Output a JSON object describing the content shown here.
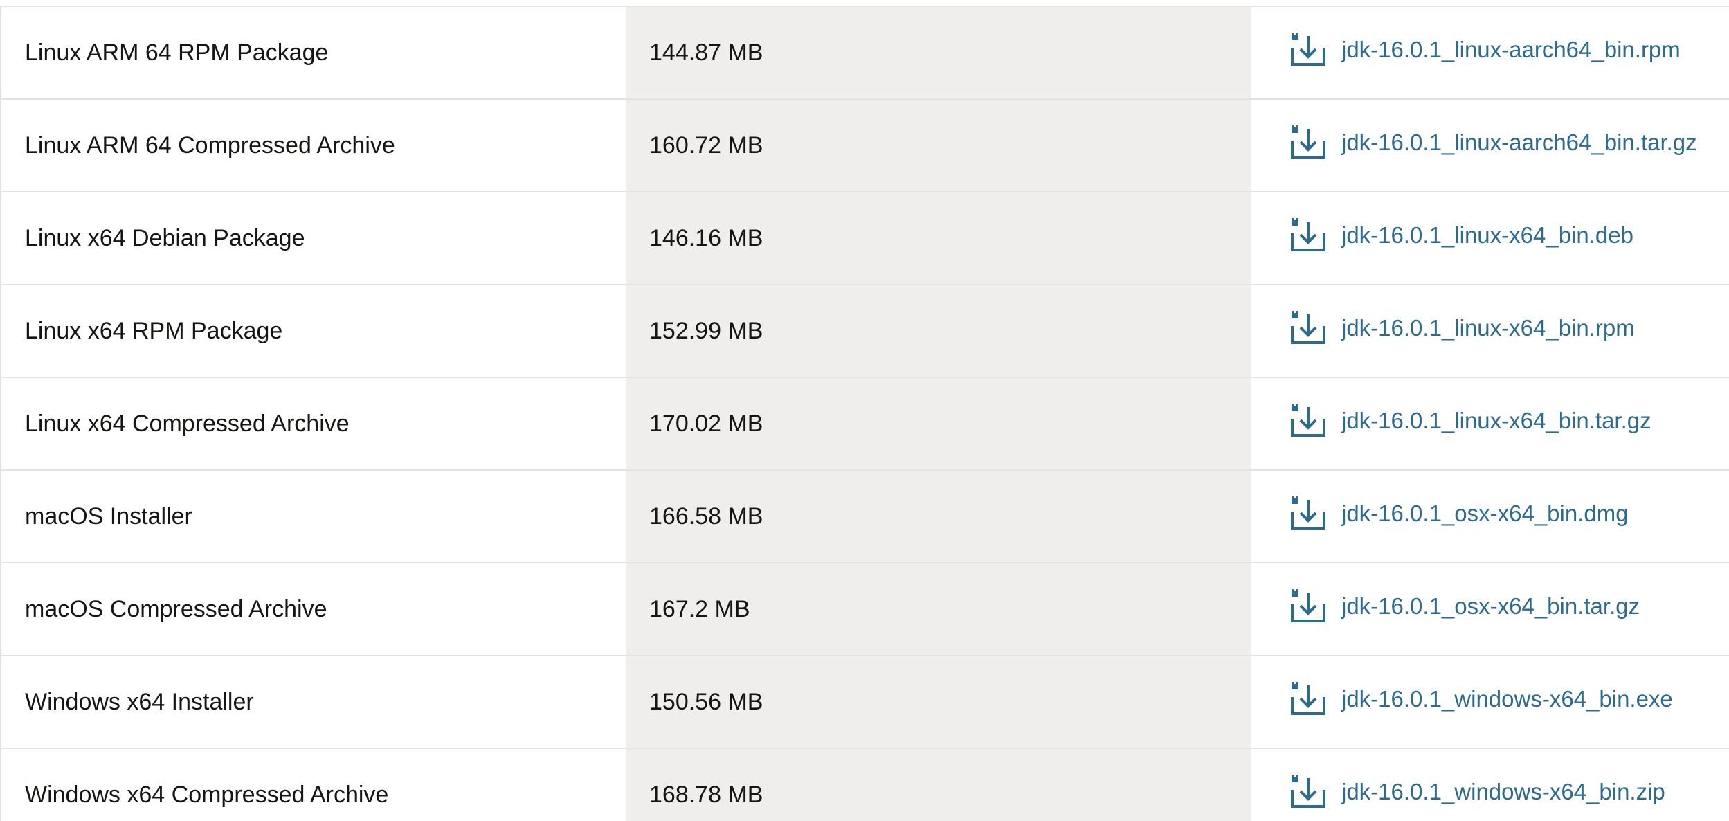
{
  "colors": {
    "link": "#2c6a8e",
    "text": "#161513",
    "size_column_bg": "#efeeec",
    "row_border": "#e4e2df"
  },
  "downloads": {
    "rows": [
      {
        "product": "Linux ARM 64 RPM Package",
        "size": "144.87 MB",
        "file": "jdk-16.0.1_linux-aarch64_bin.rpm",
        "icon": "download-icon"
      },
      {
        "product": "Linux ARM 64 Compressed Archive",
        "size": "160.72 MB",
        "file": "jdk-16.0.1_linux-aarch64_bin.tar.gz",
        "icon": "download-icon"
      },
      {
        "product": "Linux x64 Debian Package",
        "size": "146.16 MB",
        "file": "jdk-16.0.1_linux-x64_bin.deb",
        "icon": "download-icon"
      },
      {
        "product": "Linux x64 RPM Package",
        "size": "152.99 MB",
        "file": "jdk-16.0.1_linux-x64_bin.rpm",
        "icon": "download-icon"
      },
      {
        "product": "Linux x64 Compressed Archive",
        "size": "170.02 MB",
        "file": "jdk-16.0.1_linux-x64_bin.tar.gz",
        "icon": "download-icon"
      },
      {
        "product": "macOS Installer",
        "size": "166.58 MB",
        "file": "jdk-16.0.1_osx-x64_bin.dmg",
        "icon": "download-icon"
      },
      {
        "product": "macOS Compressed Archive",
        "size": "167.2 MB",
        "file": "jdk-16.0.1_osx-x64_bin.tar.gz",
        "icon": "download-icon"
      },
      {
        "product": "Windows x64 Installer",
        "size": "150.56 MB",
        "file": "jdk-16.0.1_windows-x64_bin.exe",
        "icon": "download-icon"
      },
      {
        "product": "Windows x64 Compressed Archive",
        "size": "168.78 MB",
        "file": "jdk-16.0.1_windows-x64_bin.zip",
        "icon": "download-icon"
      }
    ]
  }
}
